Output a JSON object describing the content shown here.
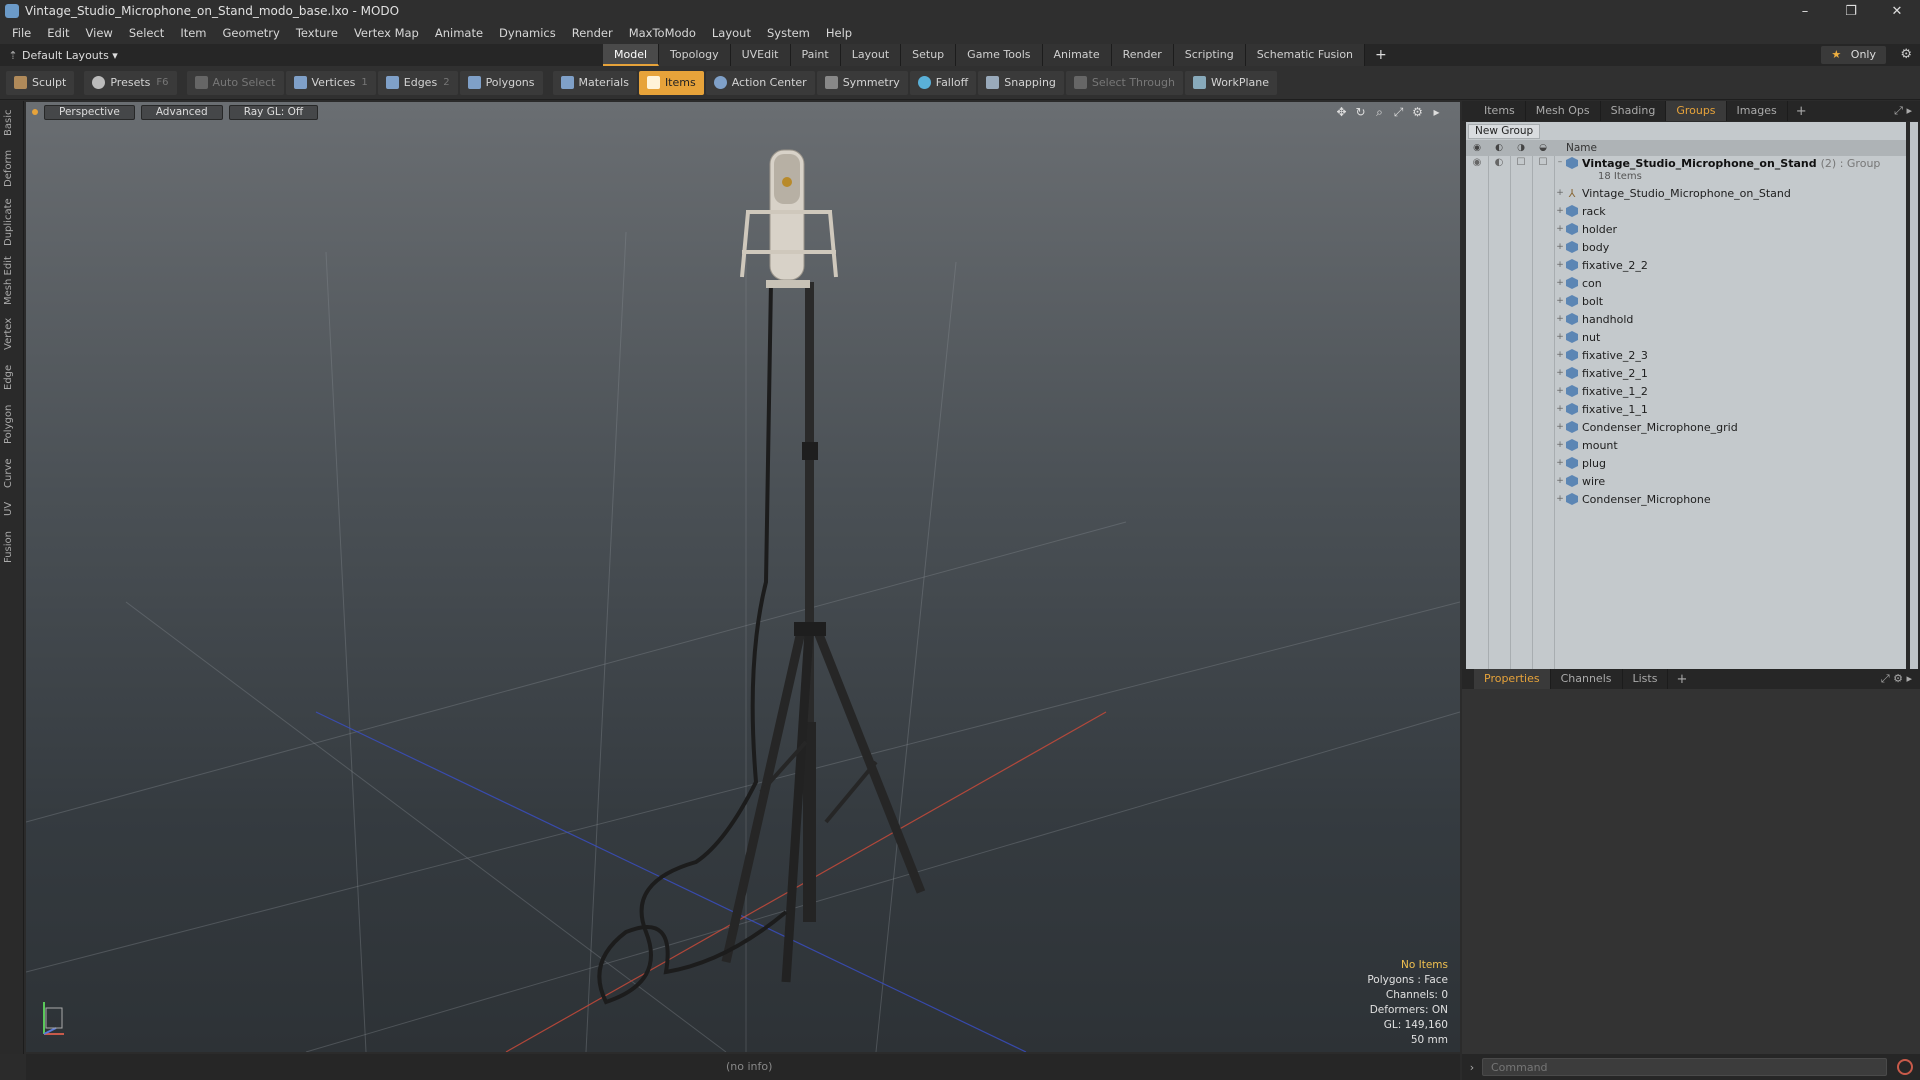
{
  "window": {
    "title": "Vintage_Studio_Microphone_on_Stand_modo_base.lxo - MODO",
    "controls": {
      "minimize": "–",
      "restore": "❐",
      "close": "✕"
    }
  },
  "menu": [
    "File",
    "Edit",
    "View",
    "Select",
    "Item",
    "Geometry",
    "Texture",
    "Vertex Map",
    "Animate",
    "Dynamics",
    "Render",
    "MaxToModo",
    "Layout",
    "System",
    "Help"
  ],
  "layout": {
    "selector": "Default Layouts ▾",
    "tabs": [
      "Model",
      "Topology",
      "UVEdit",
      "Paint",
      "Layout",
      "Setup",
      "Game Tools",
      "Animate",
      "Render",
      "Scripting",
      "Schematic Fusion"
    ],
    "active_tab": "Model",
    "only_label": "Only",
    "add_tab": "+"
  },
  "toolbar": {
    "sculpt": "Sculpt",
    "presets": "Presets",
    "presets_key": "F6",
    "auto_select": "Auto Select",
    "vertices": "Vertices",
    "vertices_key": "1",
    "edges": "Edges",
    "edges_key": "2",
    "polygons": "Polygons",
    "materials": "Materials",
    "items": "Items",
    "action_center": "Action Center",
    "symmetry": "Symmetry",
    "falloff": "Falloff",
    "snapping": "Snapping",
    "select_through": "Select Through",
    "workplane": "WorkPlane"
  },
  "left_tabs": [
    "Basic",
    "Deform",
    "Duplicate",
    "Mesh Edit",
    "Vertex",
    "Edge",
    "Polygon",
    "Curve",
    "UV",
    "Fusion"
  ],
  "viewport": {
    "view": "Perspective",
    "shading": "Advanced",
    "raygl": "Ray GL: Off",
    "info": {
      "selection": "No Items",
      "polygons": "Polygons : Face",
      "channels": "Channels: 0",
      "deformers": "Deformers: ON",
      "gl": "GL: 149,160",
      "focal": "50 mm"
    }
  },
  "status": {
    "text": "(no info)"
  },
  "groups": {
    "tabs": [
      "Items",
      "Mesh Ops",
      "Shading",
      "Groups",
      "Images"
    ],
    "active_tab": "Groups",
    "new_group": "New Group",
    "column_name": "Name",
    "group_name": "Vintage_Studio_Microphone_on_Stand",
    "group_extra": "(2) : Group",
    "group_count": "18 Items",
    "locator": "Vintage_Studio_Microphone_on_Stand",
    "items": [
      "rack",
      "holder",
      "body",
      "fixative_2_2",
      "con",
      "bolt",
      "handhold",
      "nut",
      "fixative_2_3",
      "fixative_2_1",
      "fixative_1_2",
      "fixative_1_1",
      "Condenser_Microphone_grid",
      "mount",
      "plug",
      "wire",
      "Condenser_Microphone"
    ]
  },
  "properties": {
    "tabs": [
      "Properties",
      "Channels",
      "Lists"
    ],
    "active_tab": "Properties"
  },
  "command": {
    "placeholder": "Command"
  },
  "colors": {
    "accent": "#e7a33a",
    "mesh_icon": "#5c86b4",
    "list_bg": "#c4c9cc"
  }
}
